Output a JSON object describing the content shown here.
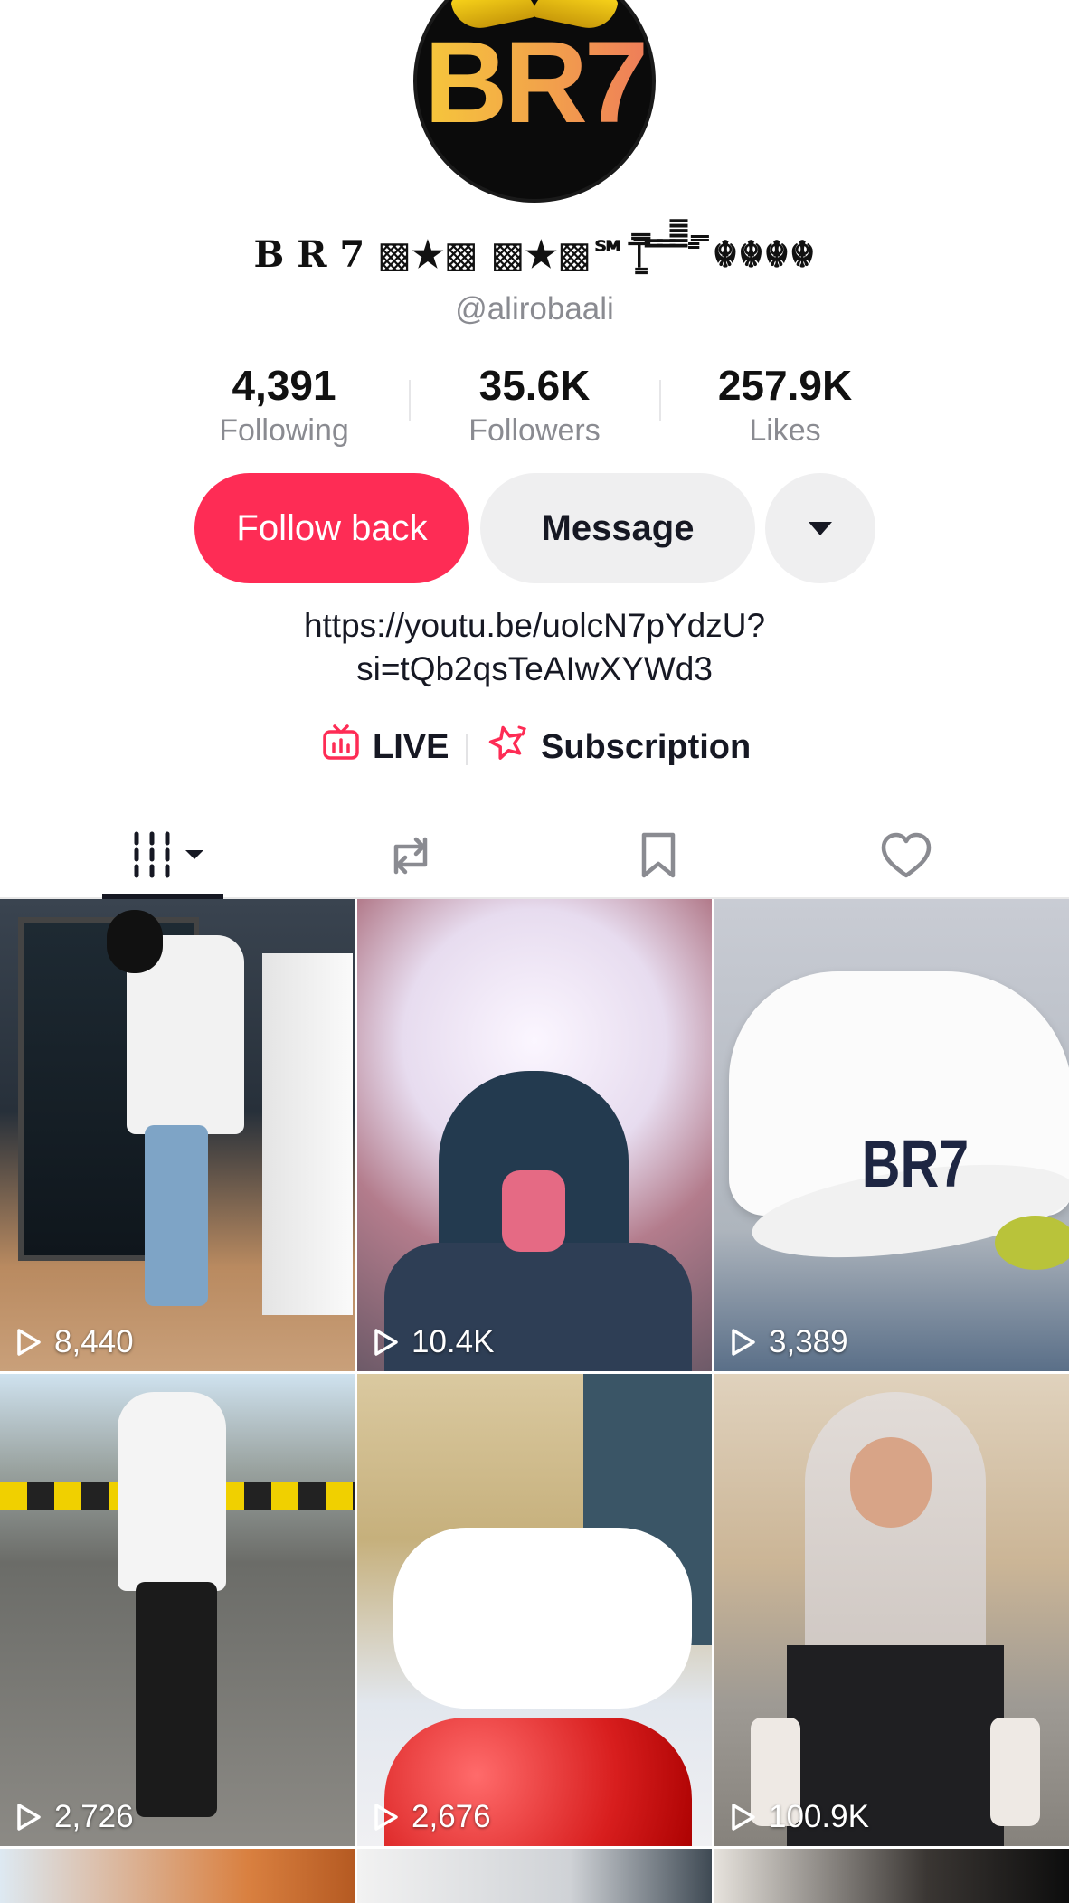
{
  "profile": {
    "avatar_text": "BR7",
    "display_name": "B R 7 ▩★▩ ▩★▩℠⍑͇̿ ̿ ̿ ̿̿̿̿̿˭̿ ☬☬☬☬",
    "username": "@alirobaali",
    "bio": [
      "https://youtu.be/uolcN7pYdzU?",
      "si=tQb2qsTeAIwXYWd3"
    ]
  },
  "stats": [
    {
      "value": "4,391",
      "label": "Following"
    },
    {
      "value": "35.6K",
      "label": "Followers"
    },
    {
      "value": "257.9K",
      "label": "Likes"
    }
  ],
  "actions": {
    "follow_back": "Follow back",
    "message": "Message"
  },
  "links": {
    "live": "LIVE",
    "subscription": "Subscription"
  },
  "tabs": [
    {
      "icon": "grid-icon",
      "active": true
    },
    {
      "icon": "repost-icon",
      "active": false
    },
    {
      "icon": "bookmark-icon",
      "active": false
    },
    {
      "icon": "heart-icon",
      "active": false
    }
  ],
  "videos": [
    {
      "views": "8,440",
      "thumb_text": ""
    },
    {
      "views": "10.4K",
      "thumb_text": ""
    },
    {
      "views": "3,389",
      "thumb_text": "BR7"
    },
    {
      "views": "2,726",
      "thumb_text": ""
    },
    {
      "views": "2,676",
      "thumb_text": ""
    },
    {
      "views": "100.9K",
      "thumb_text": ""
    }
  ],
  "colors": {
    "accent": "#fe2c55",
    "text": "#161823",
    "muted": "#8a8b91",
    "button_bg": "#efeff0"
  }
}
